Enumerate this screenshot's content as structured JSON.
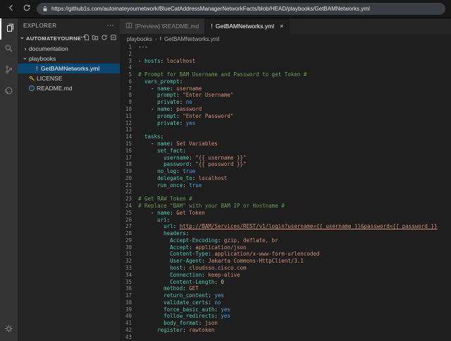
{
  "browser": {
    "url": "https://github1s.com/automateyournetwork/BlueCatAddressManagerNetworkFacts/blob/HEAD/playbooks/GetBAMNetworks.yml"
  },
  "colors": {
    "key": "#4ec9b0",
    "string": "#ce9178",
    "comment": "#6a9955",
    "boolean": "#569cd6",
    "number": "#b5cea8",
    "plain": "#d4d4d4",
    "link": "#ce9178",
    "selection": "#094771",
    "activitybar": "#333333",
    "sidebar": "#252526",
    "editorbg": "#1e1e1e",
    "tabinactive": "#2d2d2d",
    "yamlicon": "#d7ba7d",
    "licenseicon": "#ccaa14",
    "readmeicon": "#519aba"
  },
  "sidebar": {
    "title": "EXPLORER",
    "root_label": "AUTOMATEYOURNETWORK/B...",
    "items": [
      {
        "label": "documentation",
        "type": "folder",
        "expanded": false
      },
      {
        "label": "playbooks",
        "type": "folder",
        "expanded": true
      },
      {
        "label": "GetBAMNetworks.yml",
        "type": "yaml-file",
        "selected": true
      },
      {
        "label": "LICENSE",
        "type": "license-file",
        "selected": false
      },
      {
        "label": "README.md",
        "type": "readme-file",
        "selected": false
      }
    ]
  },
  "tabs": [
    {
      "label": "[Preview] \\README.md",
      "active": false
    },
    {
      "label": "GetBAMNetworks.yml",
      "active": true
    }
  ],
  "breadcrumb": [
    "playbooks",
    "GetBAMNetworks.yml"
  ],
  "editor": {
    "language": "yaml",
    "lines": [
      [
        [
          "pln",
          "---"
        ]
      ],
      [],
      [
        [
          "pln",
          "- "
        ],
        [
          "key",
          "hosts"
        ],
        [
          "pln",
          ": "
        ],
        [
          "str",
          "localhost"
        ]
      ],
      [],
      [
        [
          "cmt",
          "# Prompt for BAM Username and Password to get Token #"
        ]
      ],
      [
        [
          "pln",
          "  "
        ],
        [
          "key",
          "vars_prompt"
        ],
        [
          "pln",
          ":"
        ]
      ],
      [
        [
          "pln",
          "    - "
        ],
        [
          "key",
          "name"
        ],
        [
          "pln",
          ": "
        ],
        [
          "str",
          "username"
        ]
      ],
      [
        [
          "pln",
          "      "
        ],
        [
          "key",
          "prompt"
        ],
        [
          "pln",
          ": "
        ],
        [
          "str",
          "\"Enter Username\""
        ]
      ],
      [
        [
          "pln",
          "      "
        ],
        [
          "key",
          "private"
        ],
        [
          "pln",
          ": "
        ],
        [
          "bool",
          "no"
        ]
      ],
      [
        [
          "pln",
          "    - "
        ],
        [
          "key",
          "name"
        ],
        [
          "pln",
          ": "
        ],
        [
          "str",
          "password"
        ]
      ],
      [
        [
          "pln",
          "      "
        ],
        [
          "key",
          "prompt"
        ],
        [
          "pln",
          ": "
        ],
        [
          "str",
          "\"Enter Password\""
        ]
      ],
      [
        [
          "pln",
          "      "
        ],
        [
          "key",
          "private"
        ],
        [
          "pln",
          ": "
        ],
        [
          "bool",
          "yes"
        ]
      ],
      [],
      [
        [
          "pln",
          "  "
        ],
        [
          "key",
          "tasks"
        ],
        [
          "pln",
          ":"
        ]
      ],
      [
        [
          "pln",
          "    - "
        ],
        [
          "key",
          "name"
        ],
        [
          "pln",
          ": "
        ],
        [
          "str",
          "Set Variables"
        ]
      ],
      [
        [
          "pln",
          "      "
        ],
        [
          "key",
          "set_fact"
        ],
        [
          "pln",
          ":"
        ]
      ],
      [
        [
          "pln",
          "        "
        ],
        [
          "key",
          "username"
        ],
        [
          "pln",
          ": "
        ],
        [
          "str",
          "\"{{ username }}\""
        ]
      ],
      [
        [
          "pln",
          "        "
        ],
        [
          "key",
          "password"
        ],
        [
          "pln",
          ": "
        ],
        [
          "str",
          "\"{{ password }}\""
        ]
      ],
      [
        [
          "pln",
          "      "
        ],
        [
          "key",
          "no_log"
        ],
        [
          "pln",
          ": "
        ],
        [
          "bool",
          "true"
        ]
      ],
      [
        [
          "pln",
          "      "
        ],
        [
          "key",
          "delegate_to"
        ],
        [
          "pln",
          ": "
        ],
        [
          "str",
          "localhost"
        ]
      ],
      [
        [
          "pln",
          "      "
        ],
        [
          "key",
          "run_once"
        ],
        [
          "pln",
          ": "
        ],
        [
          "bool",
          "true"
        ]
      ],
      [],
      [
        [
          "cmt",
          "# Get RAW Token #"
        ]
      ],
      [
        [
          "cmt",
          "# Replace \"BAM\" with your BAM IP or Hostname #"
        ]
      ],
      [
        [
          "pln",
          "    - "
        ],
        [
          "key",
          "name"
        ],
        [
          "pln",
          ": "
        ],
        [
          "str",
          "Get Token"
        ]
      ],
      [
        [
          "pln",
          "      "
        ],
        [
          "key",
          "uri"
        ],
        [
          "pln",
          ":"
        ]
      ],
      [
        [
          "pln",
          "        "
        ],
        [
          "key",
          "url"
        ],
        [
          "pln",
          ": "
        ],
        [
          "lnk",
          "http://BAM/Services/REST/v1/login?username={{ username }}&password={{ password }}"
        ]
      ],
      [
        [
          "pln",
          "        "
        ],
        [
          "key",
          "headers"
        ],
        [
          "pln",
          ":"
        ]
      ],
      [
        [
          "pln",
          "          "
        ],
        [
          "key",
          "Accept-Encoding"
        ],
        [
          "pln",
          ": "
        ],
        [
          "str",
          "gzip, deflate, br"
        ]
      ],
      [
        [
          "pln",
          "          "
        ],
        [
          "key",
          "Accept"
        ],
        [
          "pln",
          ": "
        ],
        [
          "str",
          "application/json"
        ]
      ],
      [
        [
          "pln",
          "          "
        ],
        [
          "key",
          "Content-Type"
        ],
        [
          "pln",
          ": "
        ],
        [
          "str",
          "application/x-www-form-urlencoded"
        ]
      ],
      [
        [
          "pln",
          "          "
        ],
        [
          "key",
          "User-Agent"
        ],
        [
          "pln",
          ": "
        ],
        [
          "str",
          "Jakarta Commons-HttpClient/3.1"
        ]
      ],
      [
        [
          "pln",
          "          "
        ],
        [
          "key",
          "host"
        ],
        [
          "pln",
          ": "
        ],
        [
          "str",
          "cloudsso.cisco.com"
        ]
      ],
      [
        [
          "pln",
          "          "
        ],
        [
          "key",
          "Connection"
        ],
        [
          "pln",
          ": "
        ],
        [
          "str",
          "keep-alive"
        ]
      ],
      [
        [
          "pln",
          "          "
        ],
        [
          "key",
          "Content-Length"
        ],
        [
          "pln",
          ": "
        ],
        [
          "num",
          "0"
        ]
      ],
      [
        [
          "pln",
          "        "
        ],
        [
          "key",
          "method"
        ],
        [
          "pln",
          ": "
        ],
        [
          "str",
          "GET"
        ]
      ],
      [
        [
          "pln",
          "        "
        ],
        [
          "key",
          "return_content"
        ],
        [
          "pln",
          ": "
        ],
        [
          "bool",
          "yes"
        ]
      ],
      [
        [
          "pln",
          "        "
        ],
        [
          "key",
          "validate_certs"
        ],
        [
          "pln",
          ": "
        ],
        [
          "bool",
          "no"
        ]
      ],
      [
        [
          "pln",
          "        "
        ],
        [
          "key",
          "force_basic_auth"
        ],
        [
          "pln",
          ": "
        ],
        [
          "bool",
          "yes"
        ]
      ],
      [
        [
          "pln",
          "        "
        ],
        [
          "key",
          "follow_redirects"
        ],
        [
          "pln",
          ": "
        ],
        [
          "bool",
          "yes"
        ]
      ],
      [
        [
          "pln",
          "        "
        ],
        [
          "key",
          "body_format"
        ],
        [
          "pln",
          ": "
        ],
        [
          "str",
          "json"
        ]
      ],
      [
        [
          "pln",
          "      "
        ],
        [
          "key",
          "register"
        ],
        [
          "pln",
          ": "
        ],
        [
          "str",
          "rawtoken"
        ]
      ],
      []
    ]
  }
}
